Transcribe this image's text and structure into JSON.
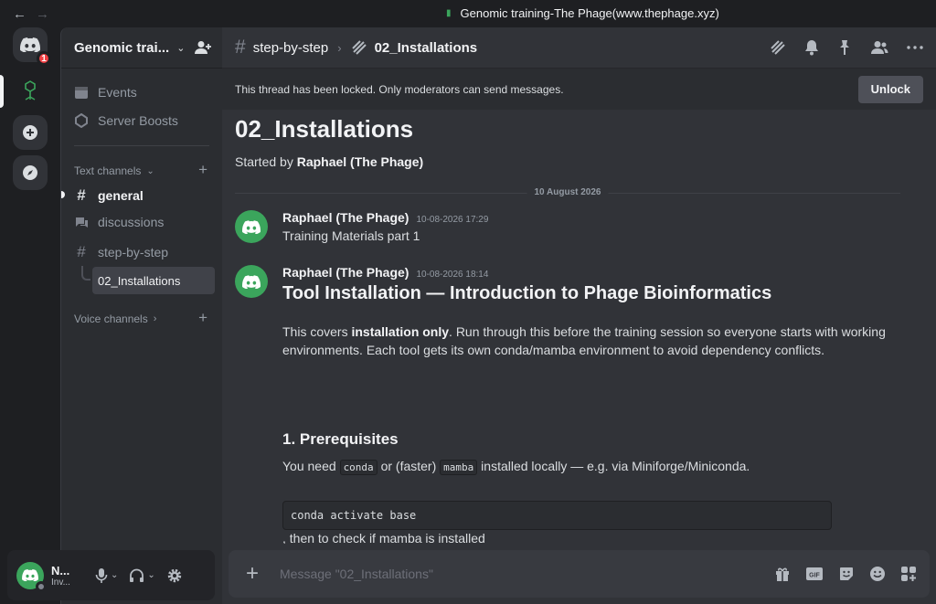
{
  "window": {
    "title": "Genomic training-The Phage(www.thephage.xyz)",
    "back": "←",
    "forward": "→"
  },
  "servers": {
    "home_badge": "1"
  },
  "sidebar": {
    "guild_name": "Genomic trai...",
    "events": "Events",
    "server_boosts": "Server Boosts",
    "text_channels": "Text channels",
    "voice_channels": "Voice channels",
    "channels": [
      "general",
      "discussions",
      "step-by-step"
    ],
    "thread": "02_Installations"
  },
  "user": {
    "name": "N...",
    "status": "Inv..."
  },
  "header": {
    "channel": "step-by-step",
    "thread": "02_Installations"
  },
  "locked": {
    "text": "This thread has been locked. Only moderators can send messages.",
    "button": "Unlock"
  },
  "thread": {
    "title": "02_Installations",
    "started_prefix": "Started by ",
    "started_by": "Raphael (The Phage)",
    "date_divider": "10 August 2026"
  },
  "messages": [
    {
      "author": "Raphael (The Phage)",
      "time": "10-08-2026 17:29",
      "text": "Training Materials part 1"
    },
    {
      "author": "Raphael (The Phage)",
      "time": "10-08-2026 18:14"
    }
  ],
  "content": {
    "heading": "Tool Installation — Introduction to Phage Bioinformatics",
    "p1_a": "This covers ",
    "p1_b": "installation only",
    "p1_c": ". Run through this before the training session so everyone starts with working",
    "p1_d": "environments. Each tool gets its own conda/mamba environment to avoid dependency conflicts.",
    "section": "1. Prerequisites",
    "p2_a": "You need ",
    "p2_code1": "conda",
    "p2_b": " or (faster) ",
    "p2_code2": "mamba",
    "p2_c": " installed locally — e.g. via Miniforge/Miniconda.",
    "code": "conda activate base",
    "p3": ", then to check if mamba is installed"
  },
  "composer": {
    "placeholder": "Message \"02_Installations\""
  },
  "colors": {
    "accent": "#3ba55c",
    "badge": "#f23f43",
    "background": "#313338"
  }
}
